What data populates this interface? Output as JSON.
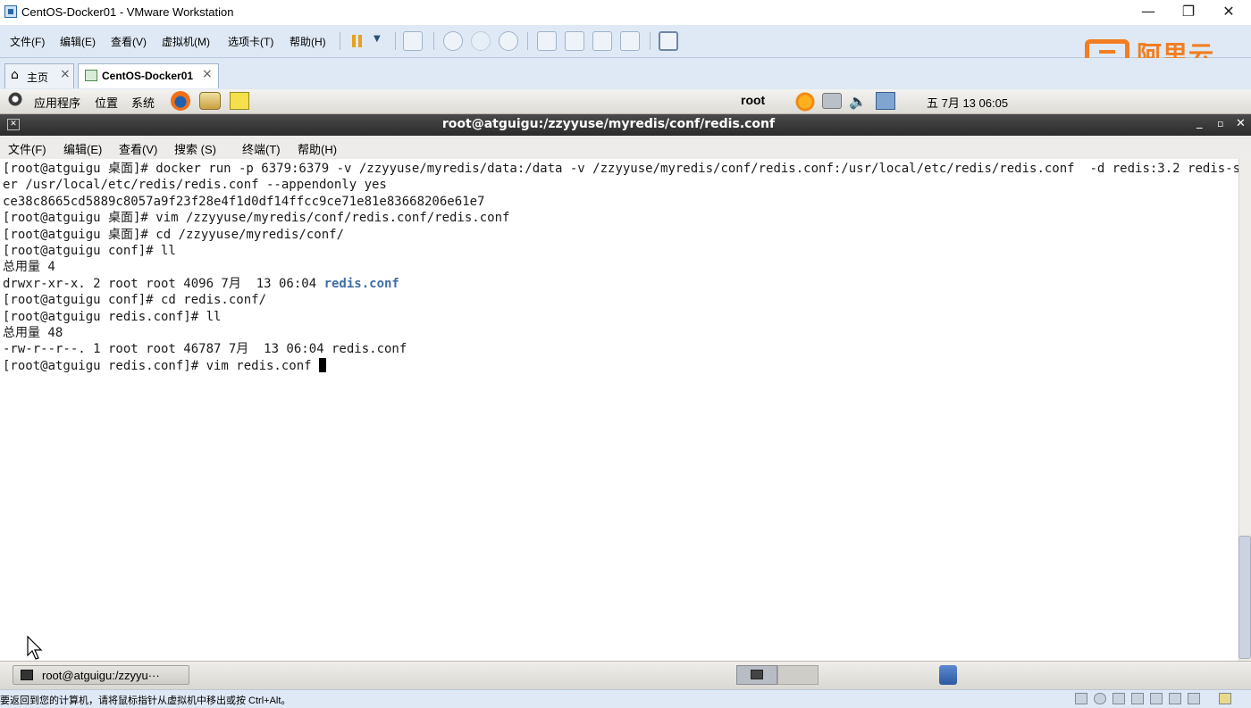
{
  "window": {
    "title": "CentOS-Docker01 - VMware Workstation"
  },
  "vm_menu": [
    "文件(F)",
    "编辑(E)",
    "查看(V)",
    "虚拟机(M)",
    "选项卡(T)",
    "帮助(H)"
  ],
  "brand": {
    "logo_text": "阿里云",
    "color": "#f27e21"
  },
  "vm_tabs": [
    {
      "label": "主页",
      "icon": "home-icon"
    },
    {
      "label": "CentOS-Docker01",
      "icon": "vm-icon"
    }
  ],
  "gnome_panel": {
    "menus": [
      "应用程序",
      "位置",
      "系统"
    ],
    "user": "root",
    "clock": "五 7月 13 06:05"
  },
  "terminal": {
    "title": "root@atguigu:/zzyyuse/myredis/conf/redis.conf",
    "menu": [
      "文件(F)",
      "编辑(E)",
      "查看(V)",
      "搜索 (S)",
      "终端(T)",
      "帮助(H)"
    ],
    "lines": [
      "[root@atguigu 桌面]# docker run -p 6379:6379 -v /zzyyuse/myredis/data:/data -v /zzyyuse/myredis/conf/redis.conf:/usr/local/etc/redis/redis.conf  -d redis:3.2 redis-serv",
      "er /usr/local/etc/redis/redis.conf --appendonly yes",
      "ce38c8665cd5889c8057a9f23f28e4f1d0df14ffcc9ce71e81e83668206e61e7",
      "[root@atguigu 桌面]# vim /zzyyuse/myredis/conf/redis.conf/redis.conf",
      "[root@atguigu 桌面]# cd /zzyyuse/myredis/conf/",
      "[root@atguigu conf]# ll",
      "总用量 4",
      "drwxr-xr-x. 2 root root 4096 7月  13 06:04 ",
      "[root@atguigu conf]# cd redis.conf/",
      "[root@atguigu redis.conf]# ll",
      "总用量 48",
      "-rw-r--r--. 1 root root 46787 7月  13 06:04 redis.conf",
      "[root@atguigu redis.conf]# vim redis.conf "
    ],
    "dir_entry": "redis.conf"
  },
  "taskbar": {
    "item_label": "root@atguigu:/zzyyu···"
  },
  "status_bar": {
    "hint": "要返回到您的计算机，请将鼠标指针从虚拟机中移出或按 Ctrl+Alt。"
  }
}
